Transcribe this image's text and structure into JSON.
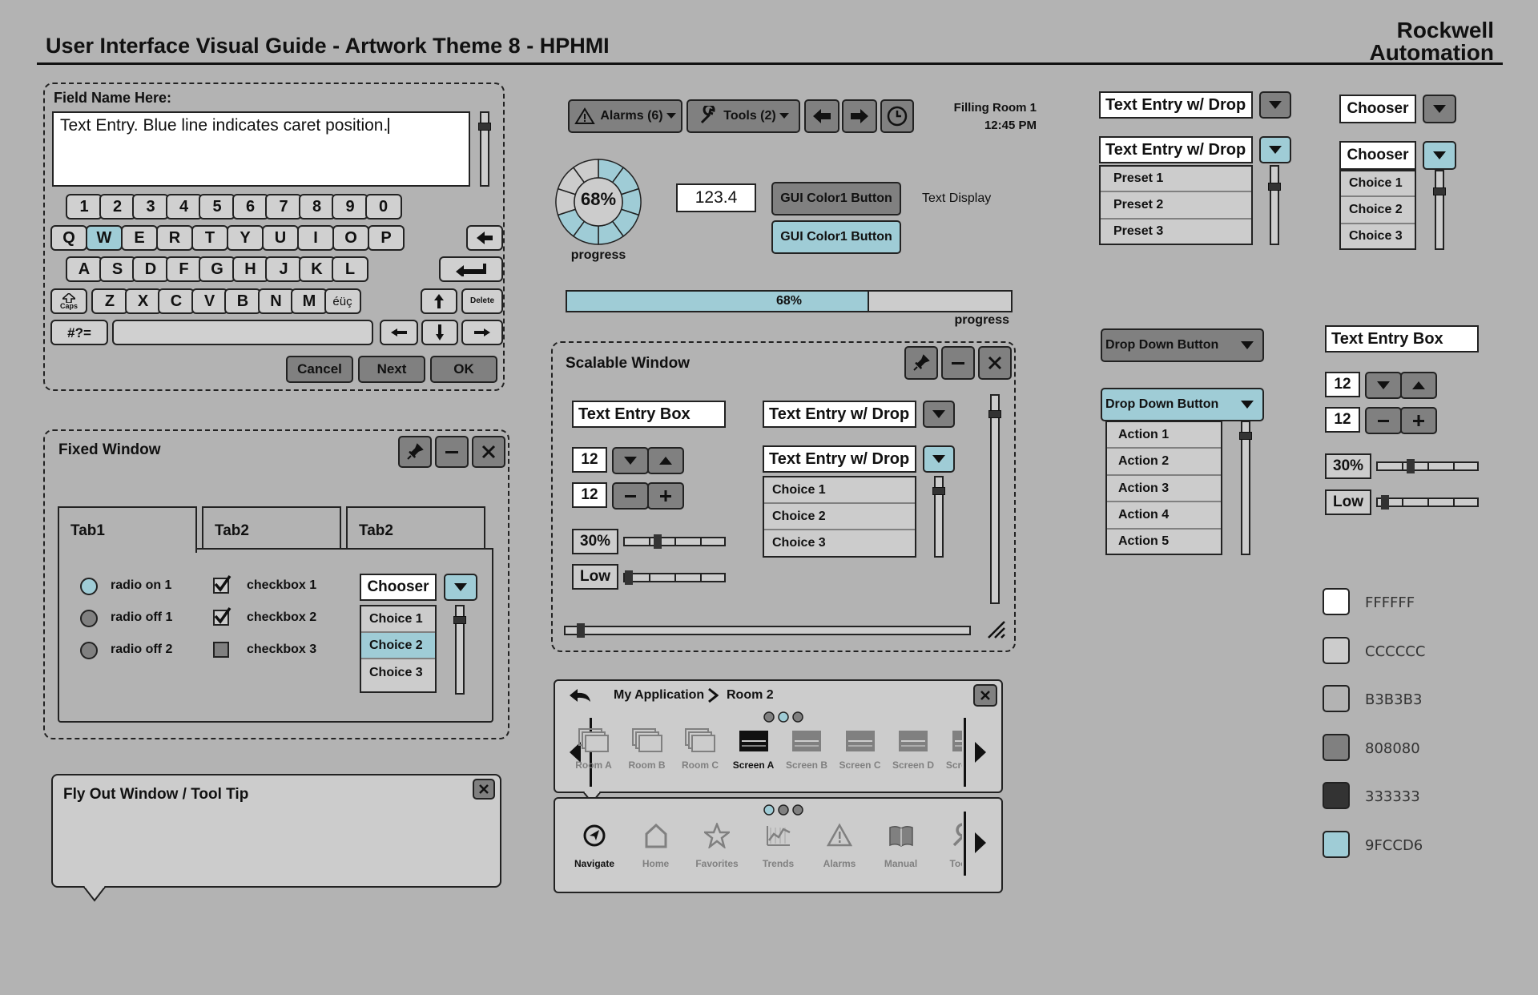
{
  "header": {
    "title": "User Interface Visual Guide - Artwork Theme 8 - HPHMI",
    "brand_line1": "Rockwell",
    "brand_line2": "Automation"
  },
  "keyboard_panel": {
    "field_label": "Field Name Here:",
    "text_value": "Text Entry. Blue line indicates caret position.",
    "rows": [
      [
        "1",
        "2",
        "3",
        "4",
        "5",
        "6",
        "7",
        "8",
        "9",
        "0"
      ],
      [
        "Q",
        "W",
        "E",
        "R",
        "T",
        "Y",
        "U",
        "I",
        "O",
        "P"
      ],
      [
        "A",
        "S",
        "D",
        "F",
        "G",
        "H",
        "J",
        "K",
        "L"
      ],
      [
        "Z",
        "X",
        "C",
        "V",
        "B",
        "N",
        "M",
        "éüç"
      ]
    ],
    "caps": "Caps",
    "delete": "Delete",
    "symbols": "#?=",
    "cancel": "Cancel",
    "next": "Next",
    "ok": "OK"
  },
  "toolbar": {
    "alarms": "Alarms (6)",
    "tools": "Tools (2)",
    "location": "Filling Room 1",
    "time": "12:45 PM"
  },
  "progress_ring": {
    "value": 0.68,
    "text": "68%",
    "label": "progress"
  },
  "numeric_display": "123.4",
  "gui_button_1": "GUI Color1 Button",
  "gui_button_2": "GUI Color1 Button",
  "text_display": "Text Display",
  "progress_bar": {
    "value": 0.68,
    "text": "68%",
    "label": "progress"
  },
  "fixed_window": {
    "title": "Fixed Window",
    "tabs": [
      "Tab1",
      "Tab2",
      "Tab2"
    ],
    "radios": [
      {
        "label": "radio on 1",
        "on": true
      },
      {
        "label": "radio off 1",
        "on": false
      },
      {
        "label": "radio off 2",
        "on": false
      }
    ],
    "checkboxes": [
      {
        "label": "checkbox 1",
        "checked": true
      },
      {
        "label": "checkbox 2",
        "checked": true
      },
      {
        "label": "checkbox 3",
        "checked": false
      }
    ],
    "chooser": {
      "label": "Chooser",
      "items": [
        "Choice 1",
        "Choice 2",
        "Choice 3"
      ],
      "selected": 1
    }
  },
  "flyout": {
    "title": "Fly Out Window / Tool Tip"
  },
  "scalable_window": {
    "title": "Scalable Window",
    "text_entry": "Text Entry Box",
    "text_drop_1": "Text Entry w/ Drop",
    "text_drop_2": "Text Entry w/ Drop",
    "choices": [
      "Choice 1",
      "Choice 2",
      "Choice 3"
    ],
    "spin_1": "12",
    "spin_2": "12",
    "pct": "30%",
    "pct_value": 0.3,
    "low": "Low"
  },
  "breadcrumb_nav": {
    "app": "My Application",
    "room": "Room 2",
    "screens": [
      "Room A",
      "Room B",
      "Room C",
      "Screen A",
      "Screen B",
      "Screen C",
      "Screen D",
      "Screen E"
    ],
    "active_screen": "Screen A"
  },
  "bottom_nav": {
    "items": [
      "Navigate",
      "Home",
      "Favorites",
      "Trends",
      "Alarms",
      "Manual",
      "Tools"
    ],
    "active": "Navigate"
  },
  "right_col_1": {
    "text_drop_1": "Text Entry w/ Drop",
    "text_drop_2": "Text Entry w/ Drop",
    "presets": [
      "Preset 1",
      "Preset 2",
      "Preset 3"
    ],
    "dd_button_1": "Drop Down Button",
    "dd_button_2": "Drop Down Button",
    "actions": [
      "Action 1",
      "Action 2",
      "Action 3",
      "Action 4",
      "Action 5"
    ]
  },
  "right_col_2": {
    "chooser_1": "Chooser",
    "chooser_2": "Chooser",
    "choices": [
      "Choice 1",
      "Choice 2",
      "Choice 3"
    ],
    "text_entry": "Text Entry Box",
    "spin_1": "12",
    "spin_2": "12",
    "pct": "30%",
    "pct_value": 0.3,
    "low": "Low"
  },
  "swatches": [
    {
      "hex": "#FFFFFF",
      "label": "FFFFFF"
    },
    {
      "hex": "#CCCCCC",
      "label": "CCCCCC"
    },
    {
      "hex": "#B3B3B3",
      "label": "B3B3B3"
    },
    {
      "hex": "#808080",
      "label": "808080"
    },
    {
      "hex": "#333333",
      "label": "333333"
    },
    {
      "hex": "#9FCCD6",
      "label": "9FCCD6"
    }
  ],
  "colors": {
    "accent": "#9FCCD6",
    "background": "#B3B3B3",
    "dark": "#333333"
  }
}
